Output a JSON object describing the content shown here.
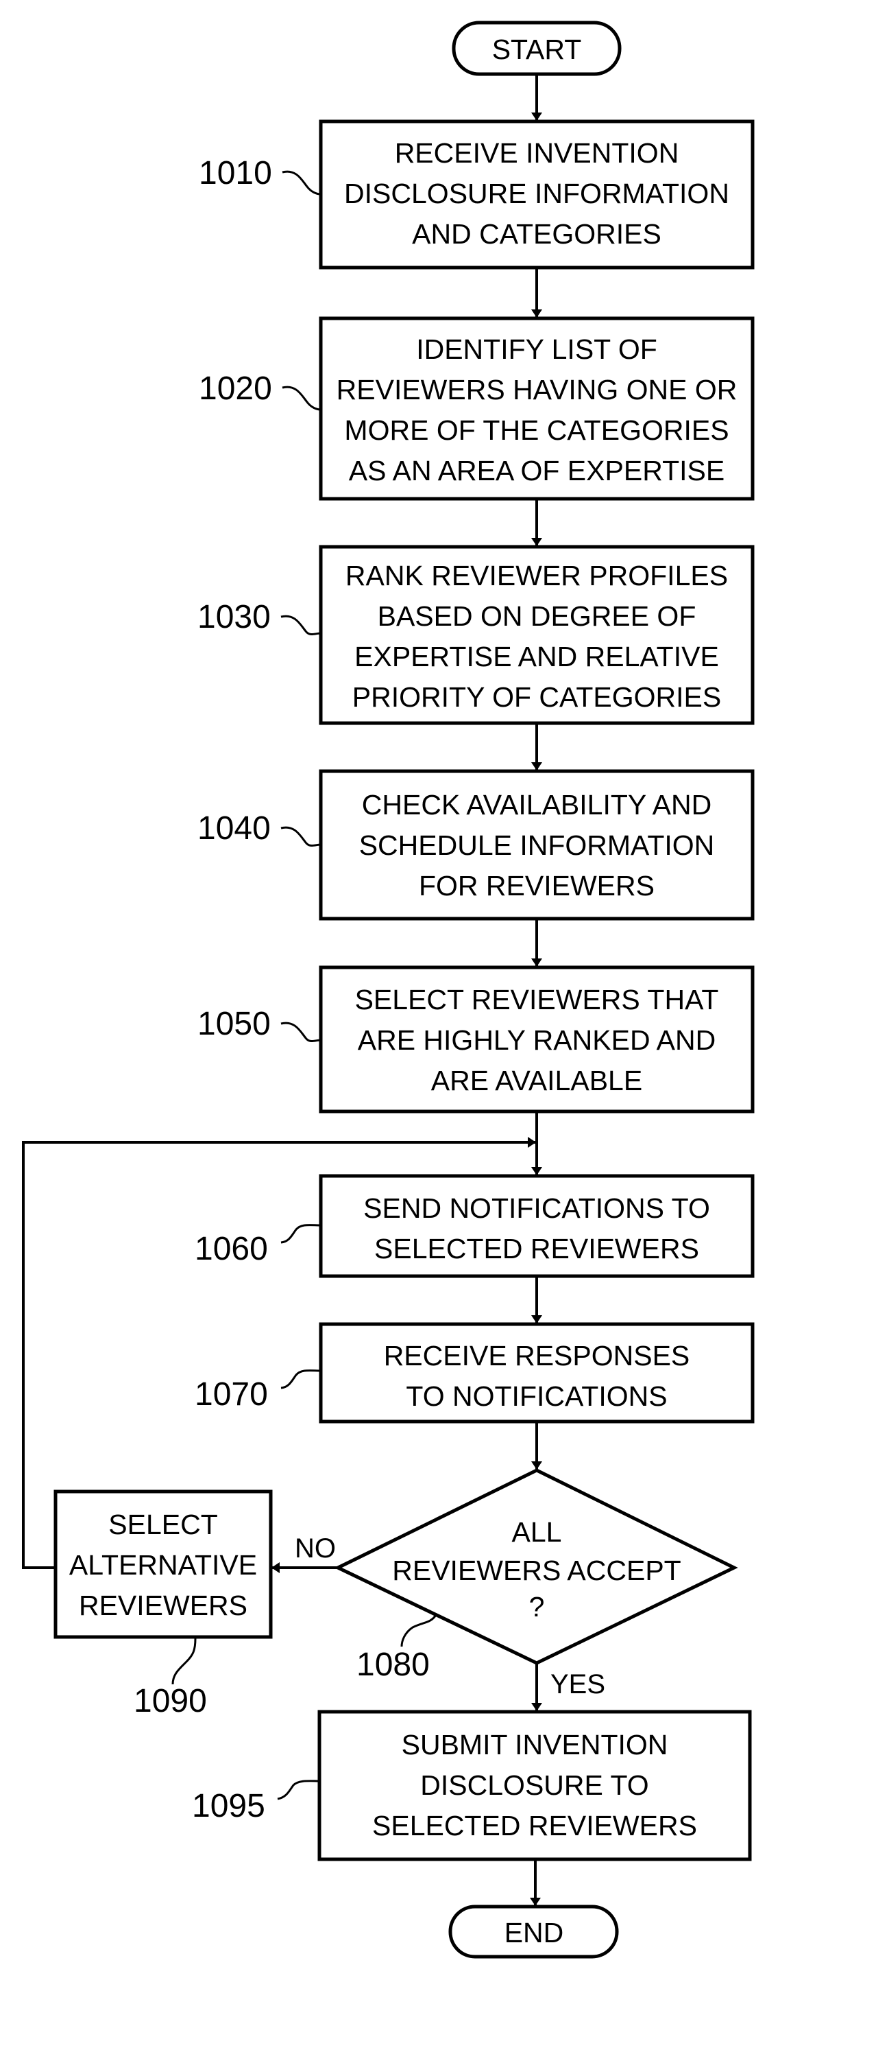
{
  "diagram": {
    "type": "flowchart",
    "start": {
      "label": "START"
    },
    "end": {
      "label": "END"
    },
    "steps": [
      {
        "ref": "1010",
        "lines": [
          "RECEIVE INVENTION",
          "DISCLOSURE INFORMATION",
          "AND CATEGORIES"
        ]
      },
      {
        "ref": "1020",
        "lines": [
          "IDENTIFY LIST OF",
          "REVIEWERS HAVING ONE OR",
          "MORE OF THE CATEGORIES",
          "AS AN AREA OF EXPERTISE"
        ]
      },
      {
        "ref": "1030",
        "lines": [
          "RANK REVIEWER PROFILES",
          "BASED ON DEGREE OF",
          "EXPERTISE AND RELATIVE",
          "PRIORITY OF CATEGORIES"
        ]
      },
      {
        "ref": "1040",
        "lines": [
          "CHECK AVAILABILITY AND",
          "SCHEDULE INFORMATION",
          "FOR REVIEWERS"
        ]
      },
      {
        "ref": "1050",
        "lines": [
          "SELECT REVIEWERS THAT",
          "ARE HIGHLY RANKED AND",
          "ARE AVAILABLE"
        ]
      },
      {
        "ref": "1060",
        "lines": [
          "SEND NOTIFICATIONS TO",
          "SELECTED REVIEWERS"
        ]
      },
      {
        "ref": "1070",
        "lines": [
          "RECEIVE RESPONSES",
          "TO NOTIFICATIONS"
        ]
      }
    ],
    "decision": {
      "ref": "1080",
      "lines": [
        "ALL",
        "REVIEWERS ACCEPT",
        "?"
      ],
      "no_label": "NO",
      "yes_label": "YES"
    },
    "alternative": {
      "ref": "1090",
      "lines": [
        "SELECT",
        "ALTERNATIVE",
        "REVIEWERS"
      ]
    },
    "final": {
      "ref": "1095",
      "lines": [
        "SUBMIT INVENTION",
        "DISCLOSURE TO",
        "SELECTED REVIEWERS"
      ]
    }
  }
}
